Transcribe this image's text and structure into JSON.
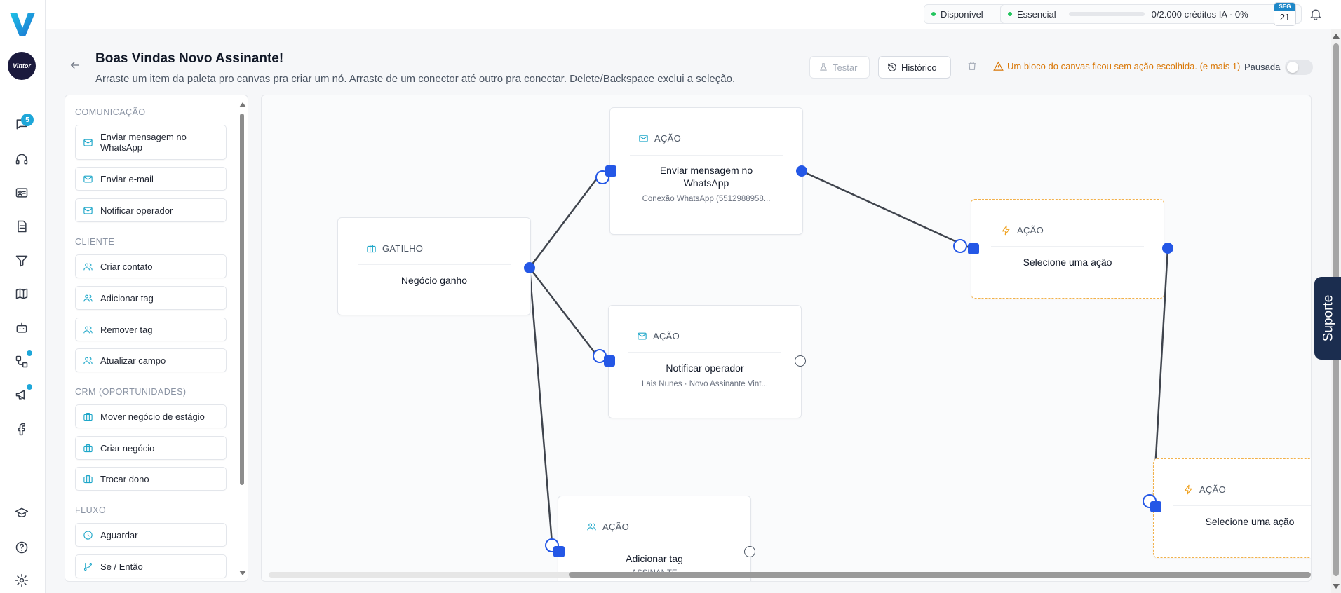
{
  "app": {
    "avatar_text": "Vintor"
  },
  "sidebar": {
    "chat_badge": "5"
  },
  "topbar": {
    "status": "Disponível",
    "plan": "Essencial",
    "credits": "0/2.000 créditos IA · 0%",
    "credits_fraction": 0,
    "calendar_weekday": "SEG",
    "calendar_day": "21"
  },
  "header": {
    "title": "Boas Vindas Novo Assinante!",
    "subtitle": "Arraste um item da paleta pro canvas pra criar um nó. Arraste de um conector até outro pra conectar. Delete/Backspace exclui a seleção.",
    "test_label": "Testar",
    "history_label": "Histórico",
    "warning": "Um bloco do canvas ficou sem ação escolhida. (e mais 1)",
    "paused_label": "Pausada",
    "paused": false
  },
  "palette": {
    "sections": {
      "comunicacao": "COMUNICAÇÃO",
      "cliente": "CLIENTE",
      "crm": "CRM (OPORTUNIDADES)",
      "fluxo": "FLUXO"
    },
    "items": {
      "whatsapp": "Enviar mensagem no WhatsApp",
      "email": "Enviar e-mail",
      "notify": "Notificar operador",
      "create_contact": "Criar contato",
      "add_tag": "Adicionar tag",
      "remove_tag": "Remover tag",
      "update_field": "Atualizar campo",
      "move_deal": "Mover negócio de estágio",
      "create_deal": "Criar negócio",
      "change_owner": "Trocar dono",
      "wait": "Aguardar",
      "if_then": "Se / Então"
    }
  },
  "canvas": {
    "trigger": {
      "kind": "GATILHO",
      "title": "Negócio ganho"
    },
    "action_whatsapp": {
      "kind": "AÇÃO",
      "title": "Enviar mensagem no WhatsApp",
      "sub": "Conexão WhatsApp (5512988958..."
    },
    "action_notify": {
      "kind": "AÇÃO",
      "title": "Notificar operador",
      "sub": "Lais Nunes · Novo Assinante Vint..."
    },
    "action_tag": {
      "kind": "AÇÃO",
      "title": "Adicionar tag",
      "sub": "ASSINANTE"
    },
    "action_empty_1": {
      "kind": "AÇÃO",
      "title": "Selecione uma ação"
    },
    "action_empty_2": {
      "kind": "AÇÃO",
      "title": "Selecione uma ação"
    }
  },
  "support": {
    "label": "Suporte"
  },
  "colors": {
    "accent": "#1ea7c9",
    "port": "#2457e6",
    "warning": "#d97706",
    "brand_dark": "#1b2d4f"
  }
}
